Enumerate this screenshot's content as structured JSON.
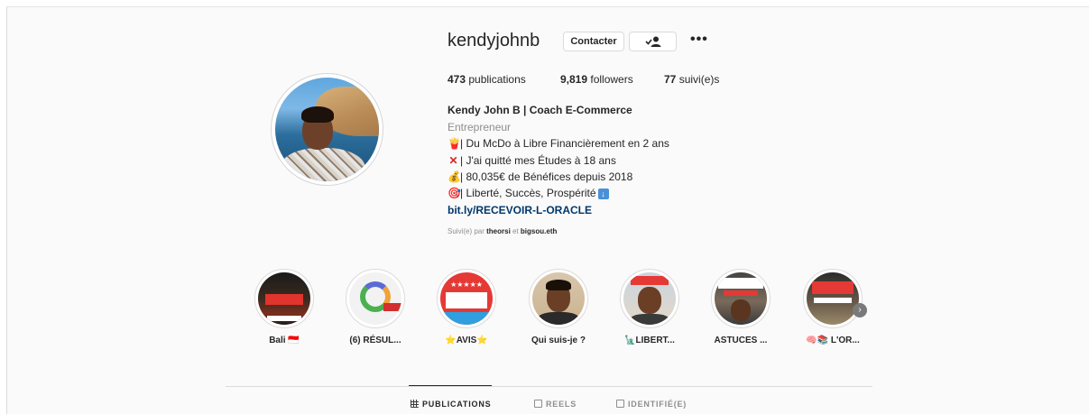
{
  "profile": {
    "username": "kendyjohnb",
    "contact_label": "Contacter",
    "more_label": "•••",
    "stats": {
      "posts_count": "473",
      "posts_label": " publications",
      "followers_count": "9,819",
      "followers_label": " followers",
      "following_count": "77",
      "following_label": " suivi(e)s"
    },
    "bio": {
      "name": "Kendy John B | Coach E-Commerce",
      "category": "Entrepreneur",
      "line1": "| Du McDo à Libre Financièrement en 2 ans",
      "line2": "| J'ai quitté mes Études à 18 ans",
      "line3": "| 80,035€ de Bénéfices depuis 2018",
      "line4": "| Liberté, Succès, Prospérité",
      "link": "bit.ly/RECEVOIR-L-ORACLE"
    },
    "followed_by": {
      "prefix": "Suivi(e) par ",
      "user1": "theorsi",
      "sep": " et ",
      "user2": "bigsou.eth"
    }
  },
  "highlights": [
    {
      "label": "Bali 🇮🇩"
    },
    {
      "label": "(6) RÉSUL..."
    },
    {
      "label": "⭐AVIS⭐"
    },
    {
      "label": "Qui suis-je ?"
    },
    {
      "label": "🗽LIBERT..."
    },
    {
      "label": "ASTUCES ..."
    },
    {
      "label": "🧠📚 L'OR..."
    }
  ],
  "tabs": [
    {
      "label": "PUBLICATIONS",
      "active": true
    },
    {
      "label": "REELS",
      "active": false
    },
    {
      "label": "IDENTIFIÉ(E)",
      "active": false
    }
  ],
  "colors": {
    "link": "#00376b",
    "muted": "#8e8e8e",
    "text": "#262626",
    "border": "#dbdbdb"
  }
}
